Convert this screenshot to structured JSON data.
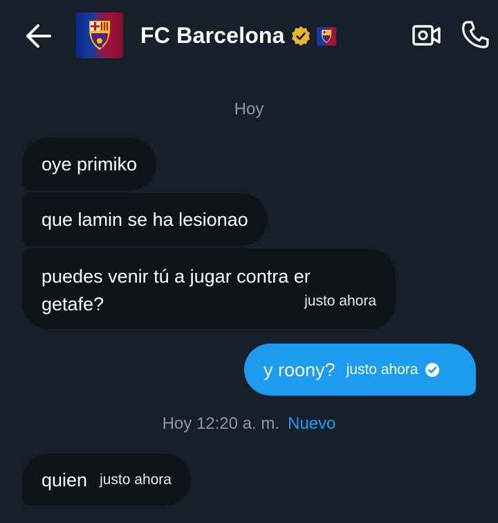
{
  "header": {
    "back_label": "Back",
    "contact_name": "FC Barcelona",
    "icons": {
      "back": "arrow-left-icon",
      "verified": "gold-verified-badge-icon",
      "affiliate": "fc-barcelona-crest-icon",
      "video": "video-camera-icon",
      "call": "phone-icon"
    }
  },
  "separators": {
    "first": "Hoy",
    "second_time": "Hoy 12:20 a. m.",
    "second_new": "Nuevo"
  },
  "messages": [
    {
      "direction": "incoming",
      "text": "oye primiko",
      "time": ""
    },
    {
      "direction": "incoming",
      "text": "que lamin se ha lesionao",
      "time": ""
    },
    {
      "direction": "incoming",
      "text": "puedes venir tú a jugar contra er getafe?",
      "time": "justo ahora"
    },
    {
      "direction": "outgoing",
      "text": "y roony?",
      "time": "justo ahora",
      "status": "read"
    },
    {
      "direction": "incoming",
      "text": "quien",
      "time": "justo ahora"
    }
  ],
  "colors": {
    "background": "#15202b",
    "incoming_bubble": "#0f1419",
    "outgoing_bubble": "#1d9bf0",
    "accent": "#1d9bf0",
    "muted_text": "#8b98a5",
    "verified_gold": "#e8b829"
  }
}
